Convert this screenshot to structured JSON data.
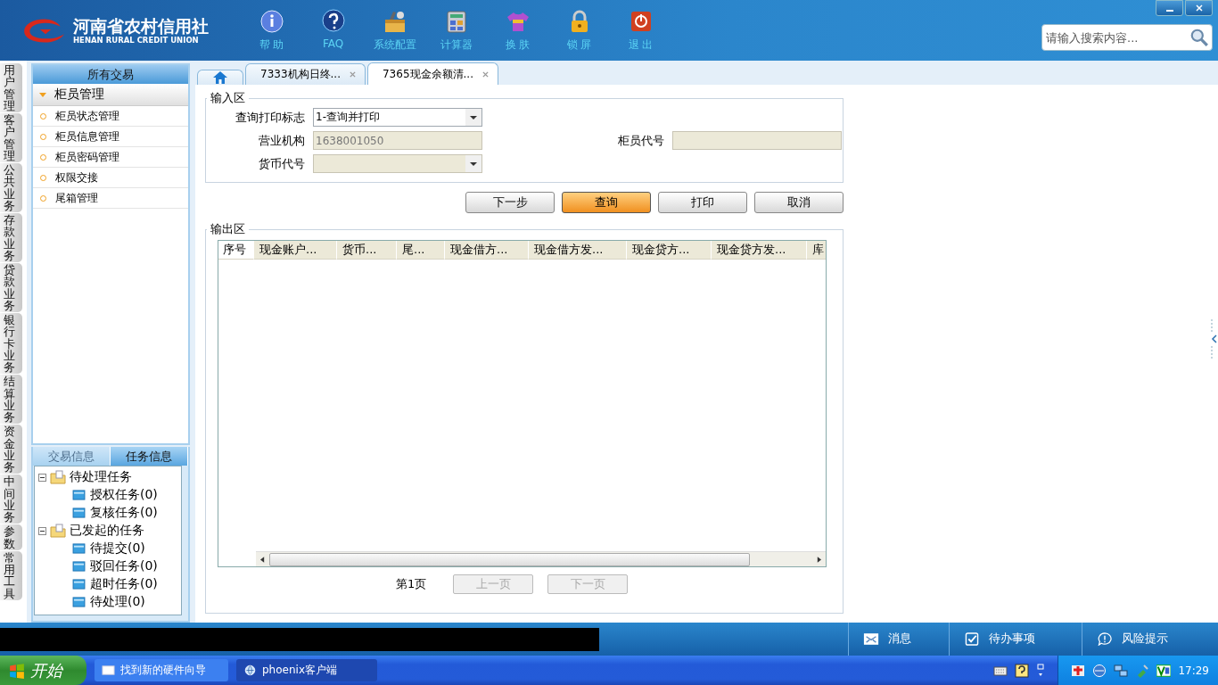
{
  "header": {
    "logo_cn": "河南省农村信用社",
    "logo_en": "HENAN RURAL CREDIT UNION",
    "tools": [
      {
        "label": "帮 助",
        "kind": "info"
      },
      {
        "label": "FAQ",
        "kind": "help"
      },
      {
        "label": "系统配置",
        "kind": "toolbox"
      },
      {
        "label": "计算器",
        "kind": "calculator"
      },
      {
        "label": "换 肤",
        "kind": "shirt"
      },
      {
        "label": "锁 屏",
        "kind": "lock"
      },
      {
        "label": "退 出",
        "kind": "power"
      }
    ],
    "search": {
      "placeholder": "请输入搜索内容..."
    }
  },
  "side_tabs": [
    "用户管理",
    "客户管理",
    "公共业务",
    "存款业务",
    "贷款业务",
    "银行卡业务",
    "结算业务",
    "资金业务",
    "中间业务",
    "参数",
    "常用工具"
  ],
  "menu": {
    "title": "所有交易",
    "group": {
      "label": "柜员管理",
      "expanded": true
    },
    "items": [
      "柜员状态管理",
      "柜员信息管理",
      "柜员密码管理",
      "权限交接",
      "尾箱管理"
    ]
  },
  "info_panel": {
    "tabs": [
      {
        "label": "交易信息",
        "selected": false
      },
      {
        "label": "任务信息",
        "selected": true
      }
    ],
    "tree": [
      {
        "label": "待处理任务",
        "expanded": true,
        "children": [
          {
            "label": "授权任务(0)"
          },
          {
            "label": "复核任务(0)"
          }
        ]
      },
      {
        "label": "已发起的任务",
        "expanded": true,
        "children": [
          {
            "label": "待提交(0)"
          },
          {
            "label": "驳回任务(0)"
          },
          {
            "label": "超时任务(0)"
          },
          {
            "label": "待处理(0)"
          }
        ]
      }
    ]
  },
  "doc_tabs": [
    {
      "kind": "home",
      "selected": false
    },
    {
      "kind": "page",
      "label": "7333机构日终...",
      "selected": false
    },
    {
      "kind": "page",
      "label": "7365现金余额清...",
      "selected": true
    }
  ],
  "input_area": {
    "title": "输入区",
    "fields": [
      {
        "label": "查询打印标志",
        "kind": "select",
        "value": "1-查询并打印",
        "disabled": false
      },
      {
        "label": "营业机构",
        "kind": "text",
        "value": "1638001050",
        "disabled": true
      },
      {
        "label": "柜员代号",
        "kind": "text",
        "disabled": true
      },
      {
        "label": "货币代号",
        "kind": "select",
        "disabled": true
      }
    ]
  },
  "buttons": [
    {
      "label": "下一步",
      "selected": false
    },
    {
      "label": "查询",
      "selected": true
    },
    {
      "label": "打印",
      "selected": false
    },
    {
      "label": "取消",
      "selected": false
    }
  ],
  "output_area": {
    "title": "输出区",
    "columns": [
      "序号",
      "现金账户...",
      "货币...",
      "尾...",
      "现金借方...",
      "现金借方发...",
      "现金贷方...",
      "现金贷方发...",
      "库"
    ],
    "pager": {
      "page": "第1页",
      "prev": {
        "label": "上一页",
        "disabled": true
      },
      "next": {
        "label": "下一页",
        "disabled": true
      }
    }
  },
  "status_bar": [
    {
      "label": "消息",
      "kind": "mail"
    },
    {
      "label": "待办事项",
      "kind": "check"
    },
    {
      "label": "风险提示",
      "kind": "alert"
    }
  ],
  "taskbar": {
    "start": "开始",
    "tasks": [
      {
        "label": "找到新的硬件向导",
        "kind": "window",
        "selected": false
      },
      {
        "label": "phoenix客户端",
        "kind": "app",
        "selected": true
      }
    ],
    "clock": "17:29"
  }
}
